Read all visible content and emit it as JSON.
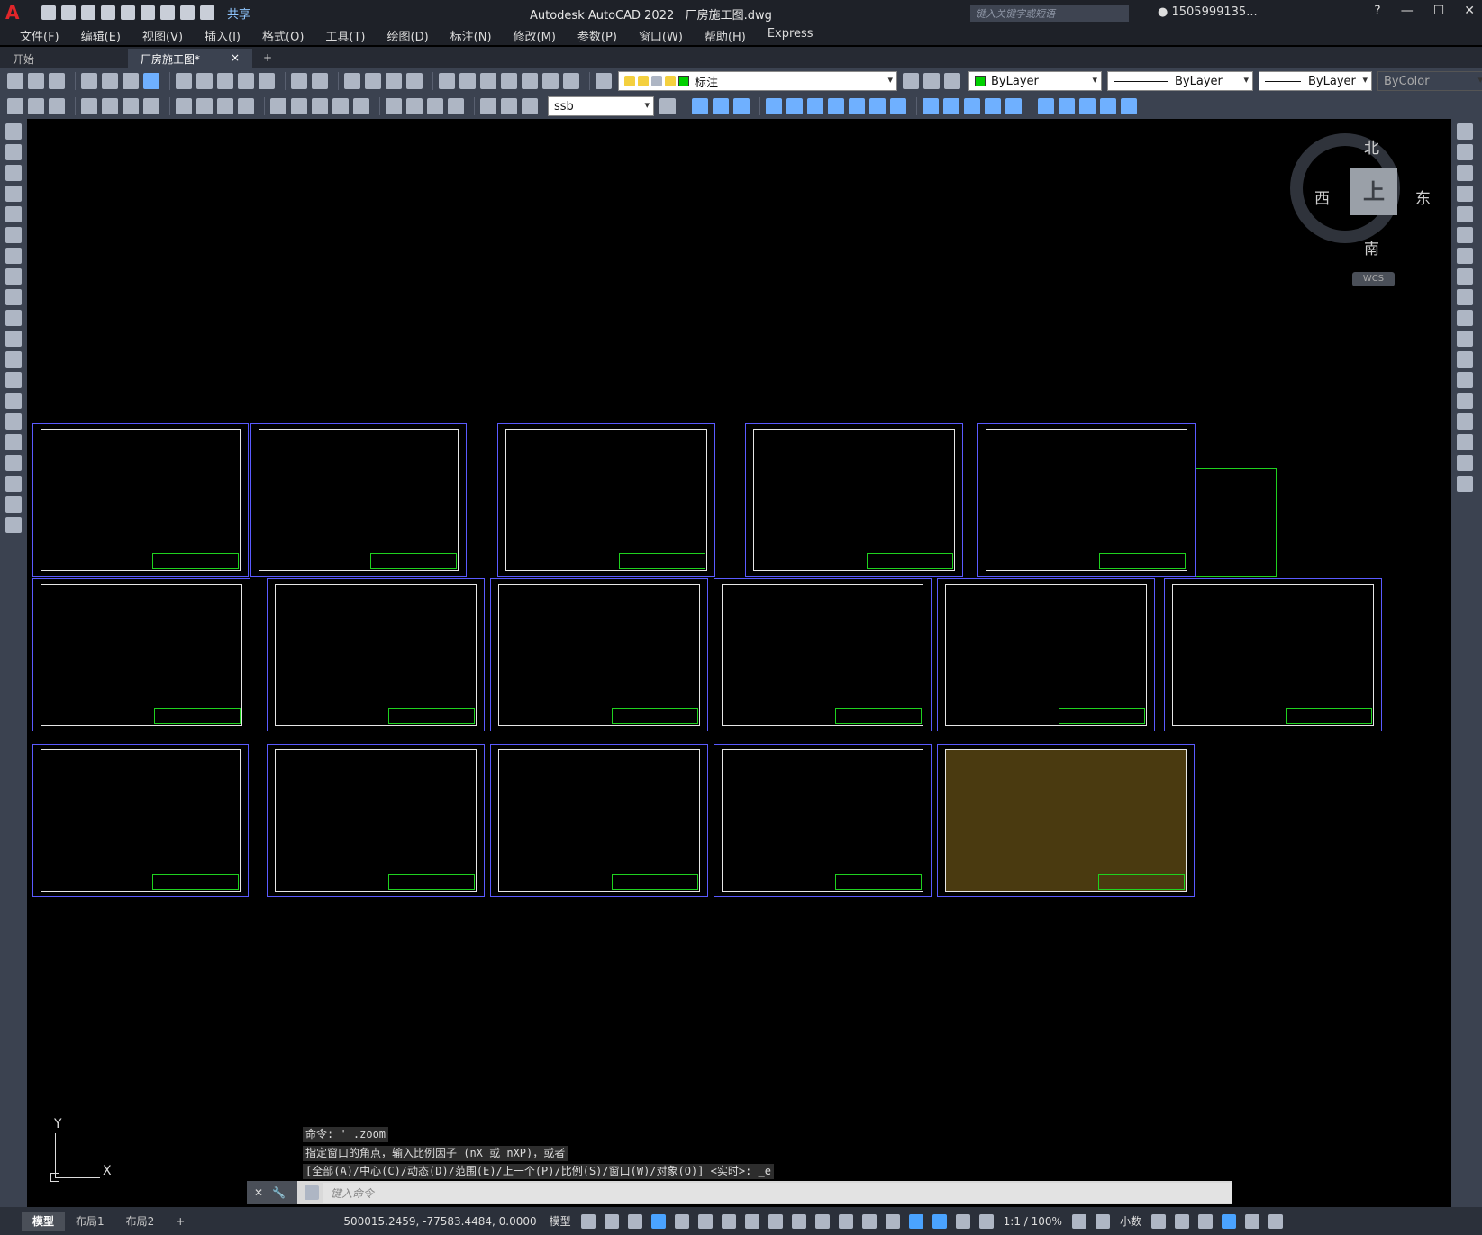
{
  "app": {
    "name": "Autodesk AutoCAD 2022",
    "file": "厂房施工图.dwg"
  },
  "titlebar": {
    "share_label": "共享",
    "search_placeholder": "键入关键字或短语",
    "user": "1505999135...",
    "help": "?"
  },
  "menu": [
    "文件(F)",
    "编辑(E)",
    "视图(V)",
    "插入(I)",
    "格式(O)",
    "工具(T)",
    "绘图(D)",
    "标注(N)",
    "修改(M)",
    "参数(P)",
    "窗口(W)",
    "帮助(H)",
    "Express"
  ],
  "doc_tabs": {
    "start": "开始",
    "active": "厂房施工图*",
    "close": "×",
    "add": "+"
  },
  "properties": {
    "layer": "标注",
    "color": "ByLayer",
    "linetype": "ByLayer",
    "lineweight": "ByLayer",
    "plotstyle": "ByColor",
    "text_style": "ssb",
    "color_swatch": "#00d000"
  },
  "viewcube": {
    "north": "北",
    "south": "南",
    "east": "东",
    "west": "西",
    "face": "上",
    "wcs": "WCS"
  },
  "ucs": {
    "x": "X",
    "y": "Y"
  },
  "command_history": [
    "命令: '_.zoom",
    "指定窗口的角点，输入比例因子 (nX 或 nXP)，或者",
    "[全部(A)/中心(C)/动态(D)/范围(E)/上一个(P)/比例(S)/窗口(W)/对象(O)] <实时>: _e"
  ],
  "command_input": {
    "placeholder": "键入命令"
  },
  "layout_tabs": [
    "模型",
    "布局1",
    "布局2"
  ],
  "layout_add": "+",
  "status": {
    "coords": "500015.2459, -77583.4484, 0.0000",
    "space": "模型",
    "scale": "1:1 / 100%",
    "units": "小数"
  },
  "colors": {
    "sheet_border": "#5a5aff",
    "titleblock": "#1fd11f",
    "background": "#000000"
  }
}
